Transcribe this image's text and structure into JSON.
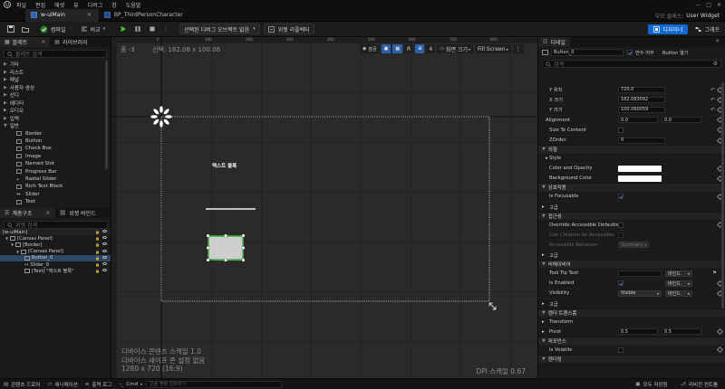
{
  "menubar": {
    "items": [
      "파일",
      "편집",
      "애셋",
      "뷰",
      "디버그",
      "창",
      "도움말"
    ],
    "window_buttons": [
      "—",
      "□",
      "✕"
    ]
  },
  "tabs": [
    {
      "label": "w-uiMain",
      "active": true
    },
    {
      "label": "BP_ThirdPersonCharacter",
      "active": false
    }
  ],
  "tabbar_right": {
    "parent_label": "부모 클래스:",
    "parent_value": "User Widget"
  },
  "toolbar": {
    "compile_label": "컴파일",
    "diff_label": "비교",
    "browse_label": "",
    "debug_select_label": "선택된 디버그 오브젝트 없음",
    "widget_reflector_label": "위젯 리플렉터",
    "designer_label": "디자이너",
    "graph_label": "그래프"
  },
  "left_panel": {
    "tabs": [
      "팔레트",
      "라이브러리"
    ],
    "search_placeholder": "팔레트 검색",
    "categories": [
      "기타",
      "리스트",
      "패널",
      "사용자 생성",
      "선디",
      "에디터",
      "오디오",
      "입력",
      "일반"
    ],
    "common_items": [
      "Border",
      "Button",
      "Check Box",
      "Image",
      "Named Slot",
      "Progress Bar",
      "Radial Slider",
      "Rich Text Block",
      "Slider",
      "Text"
    ],
    "hierarchy_tabs": [
      "계층구조",
      "위젯 바인드"
    ],
    "hierarchy_search_placeholder": "위젯 검색",
    "hierarchy": [
      {
        "label": "[w-uiMain]",
        "indent": 0,
        "selected": false
      },
      {
        "label": "[Canvas Panel]",
        "indent": 1,
        "selected": false
      },
      {
        "label": "[Border]",
        "indent": 2,
        "selected": false
      },
      {
        "label": "[Canvas Panel]",
        "indent": 3,
        "selected": false
      },
      {
        "label": "Button_0",
        "indent": 4,
        "selected": true
      },
      {
        "label": "Slider_0",
        "indent": 4,
        "selected": false
      },
      {
        "label": "[Text] \"텍스트 블록\"",
        "indent": 4,
        "selected": false
      }
    ]
  },
  "viewport": {
    "zoom_label": "줌 -3",
    "pointer_label": "선택: 182.08 x 100.06",
    "ruler_ticks": [
      "0",
      "100",
      "200",
      "300",
      "400",
      "500",
      "600",
      "700",
      "800"
    ],
    "snap_value": "4",
    "screen_size_label": "화면 크기",
    "fill_screen_label": "Fill Screen",
    "r_label": "R",
    "text_block_label": "텍스트 블록",
    "info_lines": [
      "디바이스 콘텐츠 스케일 1.0",
      "디바이스 세이프 존 설정 없음",
      "1280 x 720 (16:9)"
    ],
    "dpi_label": "DPI 스케일 0.67"
  },
  "details": {
    "header": "디테일",
    "name_value": "Button_0",
    "is_variable_label": "변수 여부",
    "open_button_label": "Button 열기",
    "search_placeholder": "검색",
    "slot_rows": [
      {
        "label": "Y 위치",
        "value": "720.0"
      },
      {
        "label": "X 크기",
        "value": "182.083092"
      },
      {
        "label": "Y 크기",
        "value": "100.060059"
      }
    ],
    "alignment_label": "Alignment",
    "alignment_values": [
      "0.0",
      "0.0"
    ],
    "size_to_content_label": "Size To Content",
    "zorder_label": "ZOrder",
    "zorder_value": "0",
    "sections": {
      "appearance": "외형",
      "style": "Style",
      "color_opacity": "Color and Opacity",
      "background_color": "Background Color",
      "interaction": "상호작용",
      "is_focusable": "Is Focusable",
      "advanced": "고급",
      "accessibility": "접근성",
      "override_access": "Override Accessible Defaults",
      "can_children": "Can Children be Accessible",
      "access_behavior": "Accessible Behavior",
      "access_behavior_value": "Summary",
      "advanced2": "고급",
      "behavior": "비헤이비어",
      "tooltip": "Tool Tip Text",
      "bind_label": "바인드",
      "is_enabled": "Is Enabled",
      "visibility": "Visibility",
      "visibility_value": "Visible",
      "advanced3": "고급",
      "render_transform": "렌더 트랜스폼",
      "transform": "Transform",
      "pivot": "Pivot",
      "pivot_values": [
        "0.5",
        "0.5"
      ],
      "performance": "퍼포먼스",
      "is_volatile": "Is Volatile",
      "rendering": "렌더링"
    }
  },
  "statusbar": {
    "content_drawer": "콘텐츠 드로어",
    "animation": "애니메이션",
    "output_log": "출력 로그",
    "cmd": "Cmd",
    "console_placeholder": "콘솔 명령 입력하기",
    "save_all": "모두 저장됨",
    "revision": "리비전 컨트롤"
  },
  "colors": {
    "accent": "#0e6ad0",
    "selection": "#2f4766",
    "button_outline": "#38b13a",
    "viewport_bg": "#2a2a2a"
  }
}
